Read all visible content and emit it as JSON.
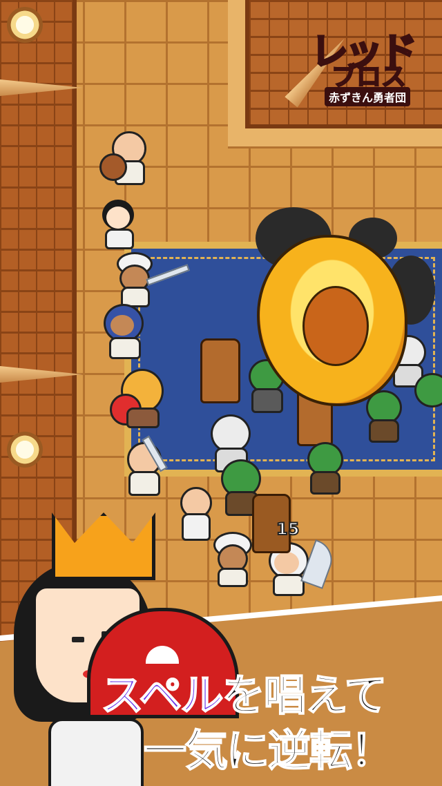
{
  "game": {
    "logo": {
      "title_line1": "レッド",
      "title_line2": "ブロス",
      "subtitle": "赤ずきん勇者団"
    },
    "damage_number": "15",
    "promo": {
      "line1_highlight": "スペル",
      "line1_rest": "を唱えて",
      "line2": "一気に逆転！"
    }
  },
  "colors": {
    "highlight": "#6a35e8",
    "banner": "#ca8b44",
    "logo_red": "#e5262b",
    "carpet": "#2f4f9a"
  }
}
